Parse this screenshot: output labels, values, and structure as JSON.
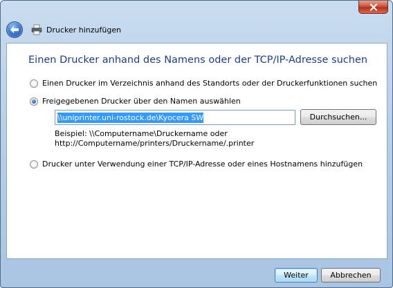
{
  "window": {
    "title": "Drucker hinzufügen",
    "icons": {
      "back": "back-arrow-icon",
      "printer": "printer-icon",
      "close": "close-icon"
    }
  },
  "main": {
    "heading": "Einen Drucker anhand des Namens oder der TCP/IP-Adresse suchen",
    "options": [
      {
        "label": "Einen Drucker im Verzeichnis anhand des Standorts oder der Druckerfunktionen suchen",
        "selected": false
      },
      {
        "label": "Freigegebenen Drucker über den Namen auswählen",
        "selected": true
      },
      {
        "label": "Drucker unter Verwendung einer TCP/IP-Adresse oder eines Hostnamens hinzufügen",
        "selected": false
      }
    ],
    "share_input": {
      "value": "\\\\uniprinter.uni-rostock.de\\Kyocera SW"
    },
    "browse_label": "Durchsuchen...",
    "hint_line1": "Beispiel: \\\\Computername\\Druckername oder",
    "hint_line2": "http://Computername/printers/Druckername/.printer"
  },
  "footer": {
    "next_label": "Weiter",
    "cancel_label": "Abbrechen"
  },
  "colors": {
    "heading": "#1e3d88",
    "selection": "#3399ff",
    "close": "#c8432b"
  }
}
